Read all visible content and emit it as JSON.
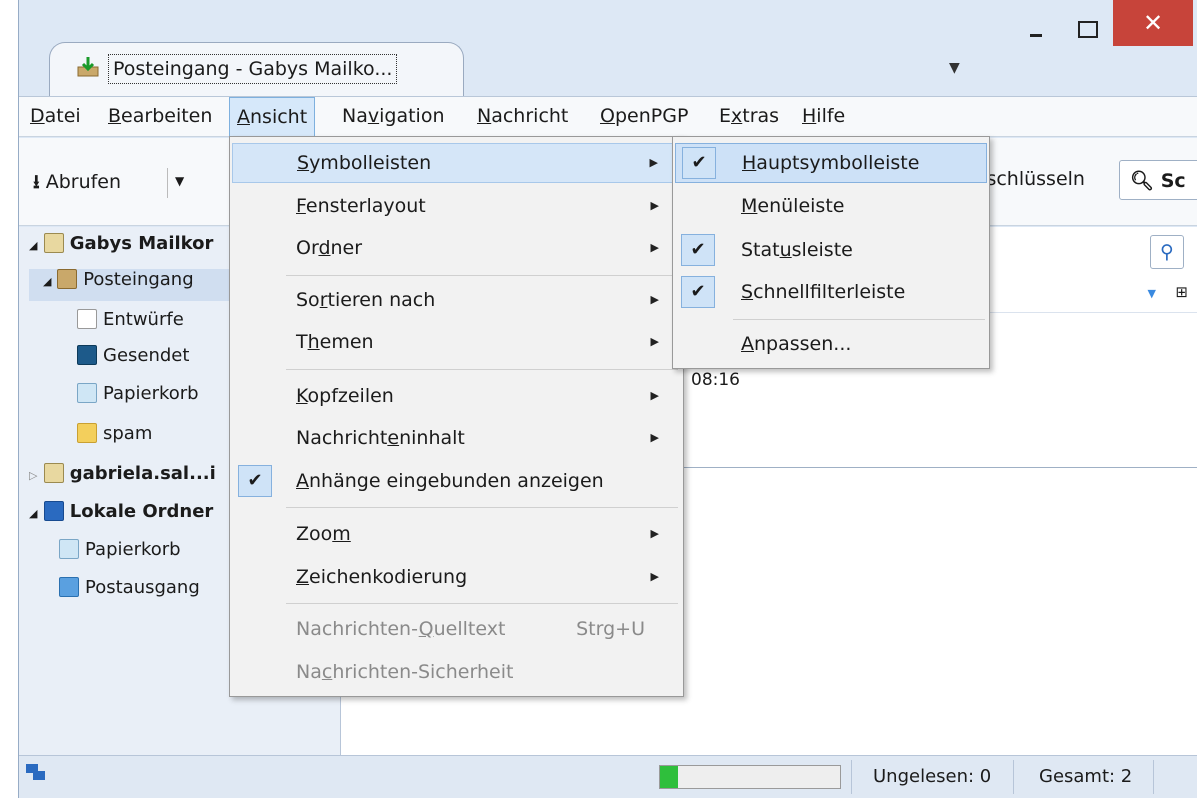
{
  "window": {
    "tab_title": "Posteingang - Gabys Mailko...",
    "close_glyph": "✕"
  },
  "menubar": {
    "items": [
      "Datei",
      "Bearbeiten",
      "Ansicht",
      "Navigation",
      "Nachricht",
      "OpenPGP",
      "Extras",
      "Hilfe"
    ]
  },
  "toolbar": {
    "abrufen": "Abrufen",
    "entschluesseln": "tschlüsseln",
    "search_partial": "Sc"
  },
  "folders": [
    {
      "label": "Gabys Mailkor",
      "bold": true
    },
    {
      "label": "Posteingang",
      "bold": false
    },
    {
      "label": "Entwürfe",
      "bold": false
    },
    {
      "label": "Gesendet",
      "bold": false
    },
    {
      "label": "Papierkorb",
      "bold": false
    },
    {
      "label": "spam",
      "bold": false
    },
    {
      "label": "gabriela.sal...i",
      "bold": true
    },
    {
      "label": "Lokale Ordner",
      "bold": true
    },
    {
      "label": "Papierkorb",
      "bold": false
    },
    {
      "label": "Postausgang",
      "bold": false
    }
  ],
  "content": {
    "time": "08:16"
  },
  "ansicht_menu": {
    "items": [
      {
        "label": "Symbolleisten"
      },
      {
        "label": "Fensterlayout"
      },
      {
        "label": "Ordner"
      },
      {
        "label": "Sortieren nach"
      },
      {
        "label": "Themen"
      },
      {
        "label": "Kopfzeilen"
      },
      {
        "label": "Nachrichteninhalt"
      },
      {
        "label": "Anhänge eingebunden anzeigen"
      },
      {
        "label": "Zoom"
      },
      {
        "label": "Zeichenkodierung"
      },
      {
        "label": "Nachrichten-Quelltext",
        "accel": "Strg+U"
      },
      {
        "label": "Nachrichten-Sicherheit"
      }
    ]
  },
  "symbolleisten_menu": {
    "items": [
      {
        "label": "Hauptsymbolleiste"
      },
      {
        "label": "Menüleiste"
      },
      {
        "label": "Statusleiste"
      },
      {
        "label": "Schnellfilterleiste"
      },
      {
        "label": "Anpassen..."
      }
    ]
  },
  "statusbar": {
    "progress": 0.1,
    "ungelesen": "Ungelesen: 0",
    "gesamt": "Gesamt: 2"
  },
  "colors": {
    "accent": "#86b1de",
    "close": "#c7443a",
    "progress": "#2fbf3c"
  }
}
